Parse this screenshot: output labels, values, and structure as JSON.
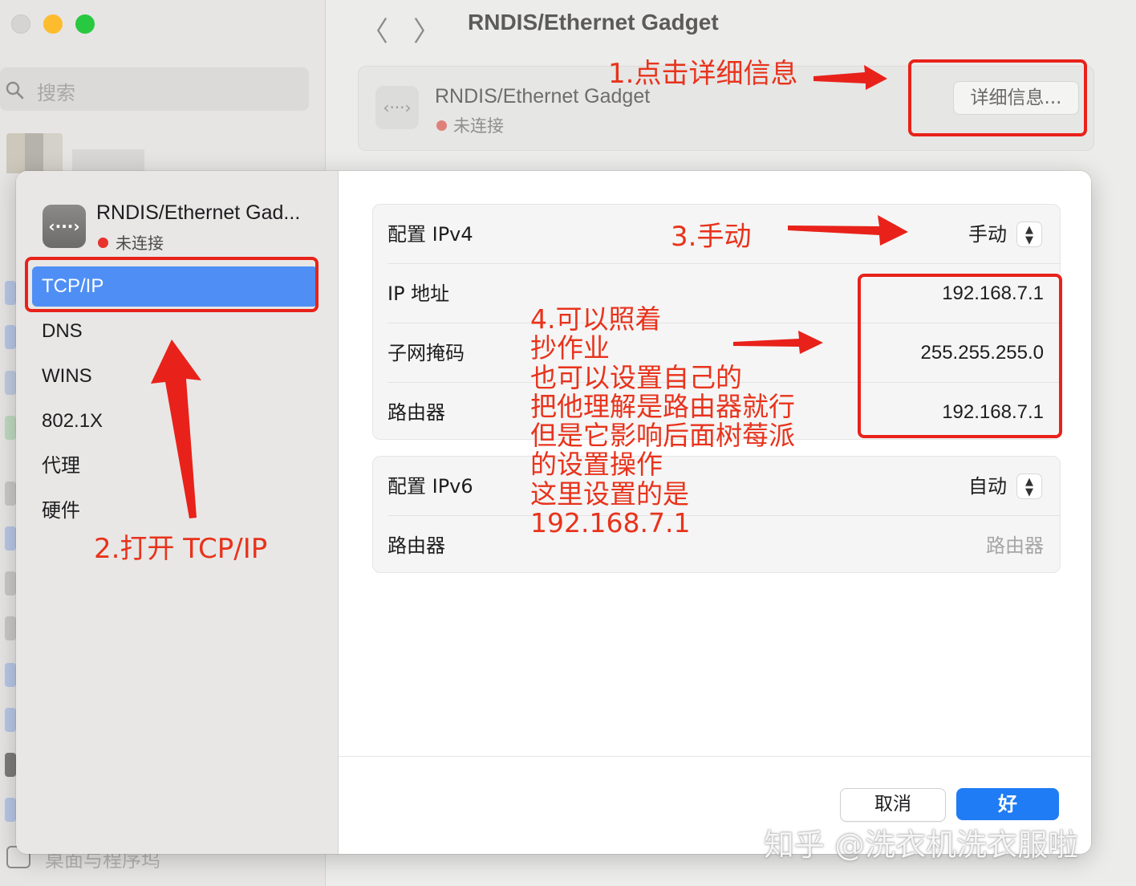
{
  "background": {
    "search_placeholder": "搜索",
    "window_title": "RNDIS/Ethernet Gadget",
    "nav": {
      "back_glyph": "〈",
      "forward_glyph": "〉"
    },
    "card": {
      "name": "RNDIS/Ethernet Gadget",
      "status": "未连接",
      "details_button": "详细信息..."
    },
    "bottom_item": "桌面与程序坞"
  },
  "sheet": {
    "device": {
      "name": "RNDIS/Ethernet Gad...",
      "status": "未连接",
      "status_color": "#e8332d",
      "icon": "ethernet-dots-icon",
      "icon_glyph": "‹···›"
    },
    "sidebar": [
      {
        "label": "TCP/IP",
        "active": true
      },
      {
        "label": "DNS",
        "active": false
      },
      {
        "label": "WINS",
        "active": false
      },
      {
        "label": "802.1X",
        "active": false
      },
      {
        "label": "代理",
        "active": false
      },
      {
        "label": "硬件",
        "active": false
      }
    ],
    "ipv4": {
      "config_label": "配置 IPv4",
      "config_value": "手动",
      "ip_label": "IP 地址",
      "ip_value": "192.168.7.1",
      "mask_label": "子网掩码",
      "mask_value": "255.255.255.0",
      "router_label": "路由器",
      "router_value": "192.168.7.1"
    },
    "ipv6": {
      "config_label": "配置 IPv6",
      "config_value": "自动",
      "router_label": "路由器",
      "router_placeholder": "路由器"
    },
    "buttons": {
      "cancel": "取消",
      "ok": "好"
    },
    "accent_color": "#1f7cf5"
  },
  "annotations": {
    "step1": "1.点击详细信息",
    "step2": "2.打开 TCP/IP",
    "step3": "3.手动",
    "step4_lines": [
      "4.可以照着",
      "抄作业",
      "也可以设置自己的",
      "把他理解是路由器就行",
      "但是它影响后面树莓派",
      "的设置操作",
      "这里设置的是",
      "192.168.7.1"
    ],
    "color": "#e8331c"
  },
  "watermark": "知乎 @洗衣机洗衣服啦"
}
